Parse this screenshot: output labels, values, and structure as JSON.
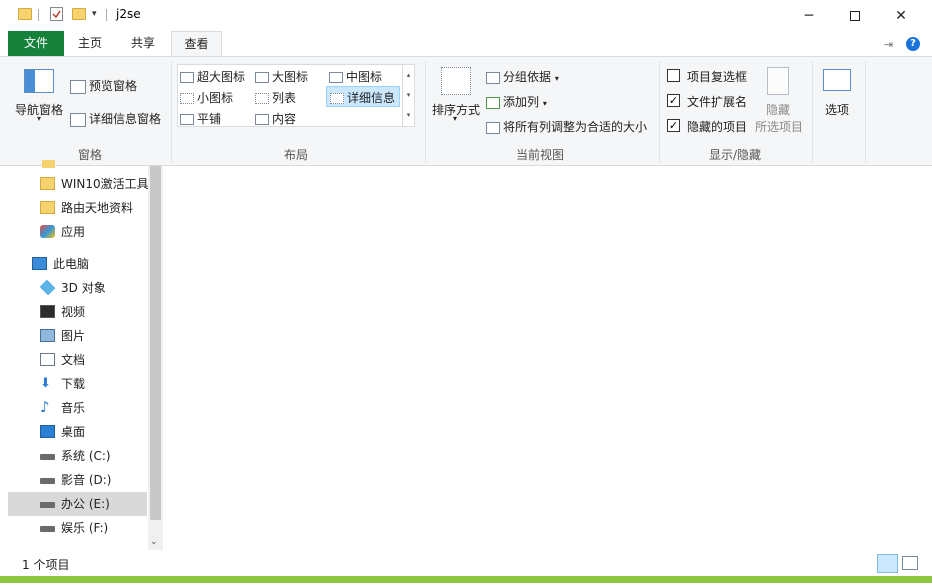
{
  "window": {
    "title": "j2se"
  },
  "tabs": {
    "file": "文件",
    "home": "主页",
    "share": "共享",
    "view": "查看"
  },
  "ribbon": {
    "panes": {
      "nav_pane": "导航窗格",
      "preview_pane": "预览窗格",
      "details_pane": "详细信息窗格",
      "group_label": "窗格"
    },
    "layout": {
      "extra_large": "超大图标",
      "large": "大图标",
      "medium": "中图标",
      "small": "小图标",
      "list": "列表",
      "details": "详细信息",
      "tiles": "平铺",
      "content": "内容",
      "group_label": "布局"
    },
    "current_view": {
      "sort_by": "排序方式",
      "group_by": "分组依据",
      "add_columns": "添加列",
      "size_all_columns": "将所有列调整为合适的大小",
      "group_label": "当前视图"
    },
    "show_hide": {
      "item_checkboxes": {
        "label": "项目复选框",
        "checked": false
      },
      "file_extensions": {
        "label": "文件扩展名",
        "checked": true
      },
      "hidden_items": {
        "label": "隐藏的项目",
        "checked": true
      },
      "hide_selected_1": "隐藏",
      "hide_selected_2": "所选项目",
      "group_label": "显示/隐藏"
    },
    "options": "选项"
  },
  "sidebar": {
    "items": [
      {
        "label": "WIN10激活工具",
        "icon": "folder-icon"
      },
      {
        "label": "路由天地资料",
        "icon": "folder-icon"
      },
      {
        "label": "应用",
        "icon": "apps-icon"
      },
      {
        "label": "此电脑",
        "icon": "computer-icon"
      },
      {
        "label": "3D 对象",
        "icon": "3d-objects-icon"
      },
      {
        "label": "视频",
        "icon": "video-icon"
      },
      {
        "label": "图片",
        "icon": "pictures-icon"
      },
      {
        "label": "文档",
        "icon": "documents-icon"
      },
      {
        "label": "下载",
        "icon": "download-icon"
      },
      {
        "label": "音乐",
        "icon": "music-icon"
      },
      {
        "label": "桌面",
        "icon": "desktop-icon"
      },
      {
        "label": "系统 (C:)",
        "icon": "drive-icon"
      },
      {
        "label": "影音 (D:)",
        "icon": "drive-icon"
      },
      {
        "label": "办公 (E:)",
        "icon": "drive-icon",
        "selected": true
      },
      {
        "label": "娱乐 (F:)",
        "icon": "drive-icon"
      }
    ]
  },
  "status": {
    "item_count": "1 个项目"
  }
}
